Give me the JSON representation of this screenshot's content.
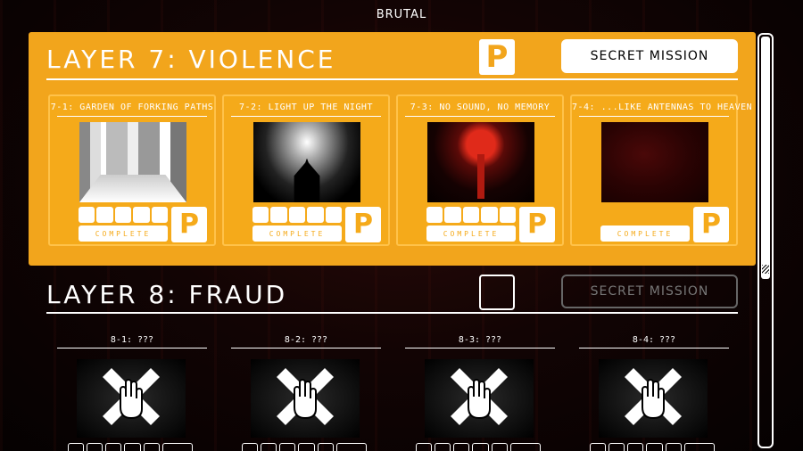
{
  "difficulty": "BRUTAL",
  "layer7": {
    "title": "LAYER 7: VIOLENCE",
    "rank": "P",
    "secret_mission": "SECRET MISSION",
    "levels": [
      {
        "title": "7-1: GARDEN OF FORKING PATHS",
        "status": "COMPLETE",
        "rank": "P"
      },
      {
        "title": "7-2: LIGHT UP THE NIGHT",
        "status": "COMPLETE",
        "rank": "P"
      },
      {
        "title": "7-3: NO SOUND, NO MEMORY",
        "status": "COMPLETE",
        "rank": "P"
      },
      {
        "title": "7-4: ...LIKE ANTENNAS TO HEAVEN",
        "status": "COMPLETE",
        "rank": "P"
      }
    ]
  },
  "layer8": {
    "title": "LAYER 8: FRAUD",
    "secret_mission": "SECRET MISSION",
    "levels": [
      {
        "title": "8-1: ???"
      },
      {
        "title": "8-2: ???"
      },
      {
        "title": "8-3: ???"
      },
      {
        "title": "8-4: ???"
      }
    ]
  },
  "colors": {
    "accent": "#f2a51c",
    "locked_border": "#666666"
  },
  "icons": {
    "locked_level": "crossed-hand-icon"
  }
}
